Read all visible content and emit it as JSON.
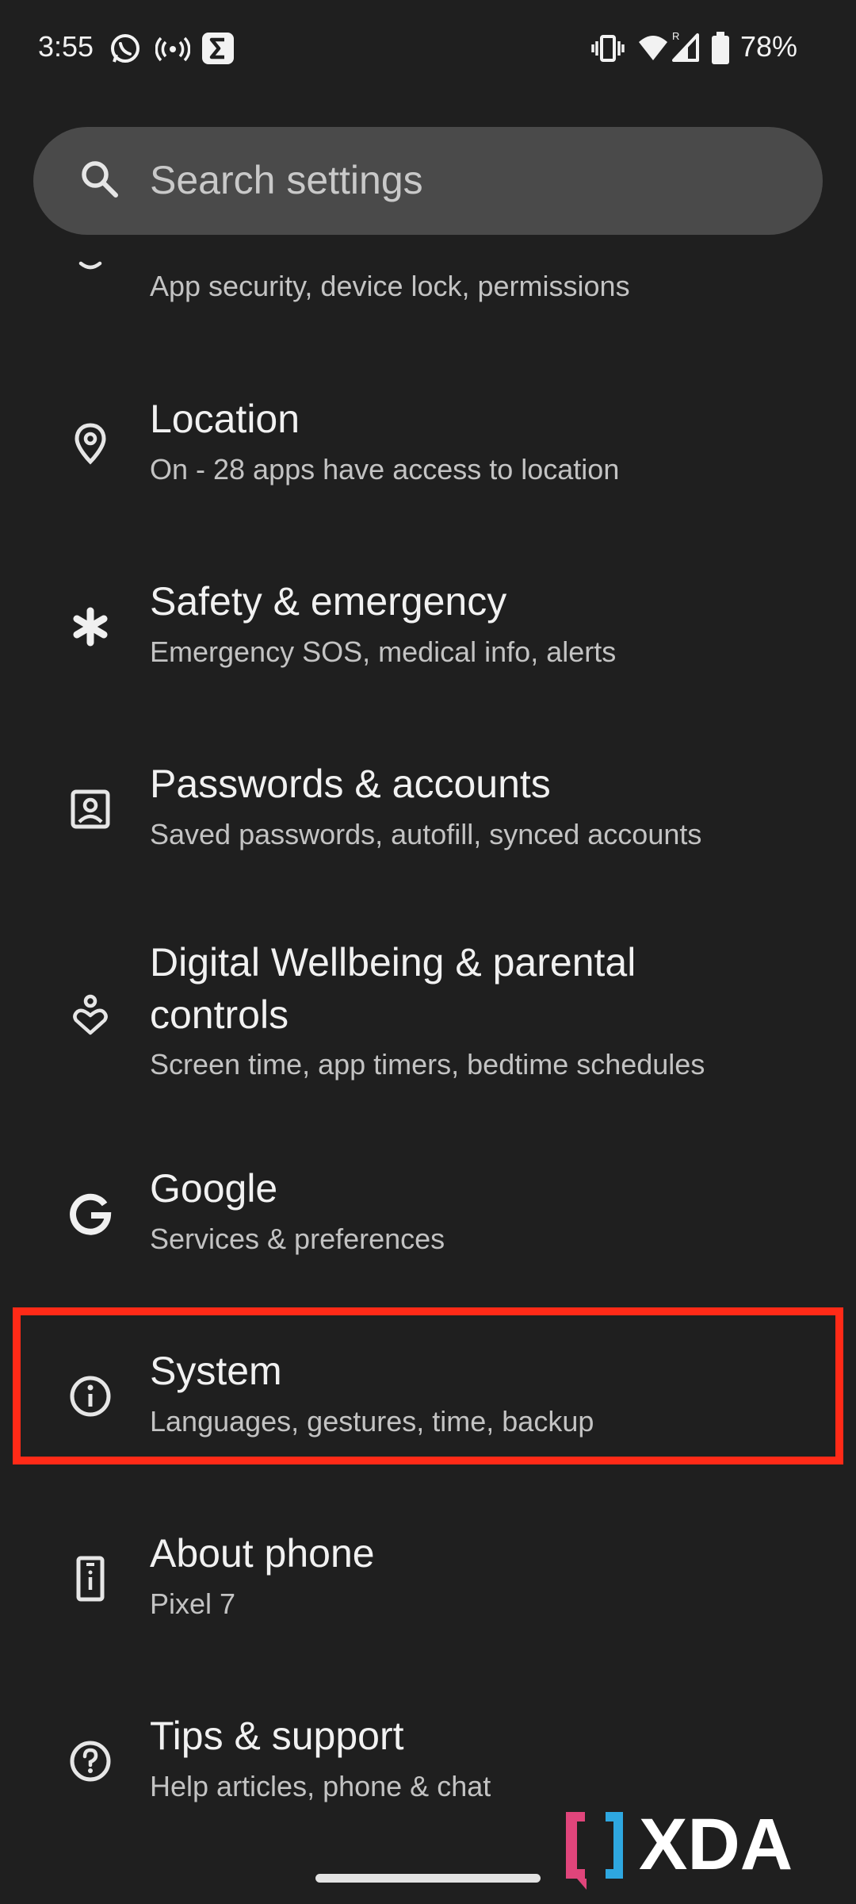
{
  "status_bar": {
    "time": "3:55",
    "battery": "78%",
    "icons": [
      "whatsapp-icon",
      "hotspot-icon",
      "sigma-app-icon",
      "vibrate-icon",
      "wifi-icon",
      "signal-icon",
      "battery-icon"
    ]
  },
  "search": {
    "placeholder": "Search settings"
  },
  "partial_item": {
    "subtitle": "App security, device lock, permissions",
    "icon": "security-icon"
  },
  "items": [
    {
      "title": "Location",
      "subtitle": "On - 28 apps have access to location",
      "icon": "location-pin-icon"
    },
    {
      "title": "Safety & emergency",
      "subtitle": "Emergency SOS, medical info, alerts",
      "icon": "asterisk-icon"
    },
    {
      "title": "Passwords & accounts",
      "subtitle": "Saved passwords, autofill, synced accounts",
      "icon": "account-box-icon"
    },
    {
      "title_line1": "Digital Wellbeing & parental",
      "title_line2": "controls",
      "subtitle": "Screen time, app timers, bedtime schedules",
      "icon": "wellbeing-icon"
    },
    {
      "title": "Google",
      "subtitle": "Services & preferences",
      "icon": "google-g-icon"
    },
    {
      "title": "System",
      "subtitle": "Languages, gestures, time, backup",
      "icon": "info-icon",
      "highlighted": true
    },
    {
      "title": "About phone",
      "subtitle": "Pixel 7",
      "icon": "phone-info-icon"
    },
    {
      "title": "Tips & support",
      "subtitle": "Help articles, phone & chat",
      "icon": "help-circle-icon"
    }
  ],
  "watermark": {
    "text": "XDA"
  },
  "colors": {
    "background": "#1f1f1f",
    "search_bg": "#4a4a4a",
    "highlight": "#ff2a17",
    "xda_pink": "#e0457b",
    "xda_blue": "#2ea7e0"
  }
}
